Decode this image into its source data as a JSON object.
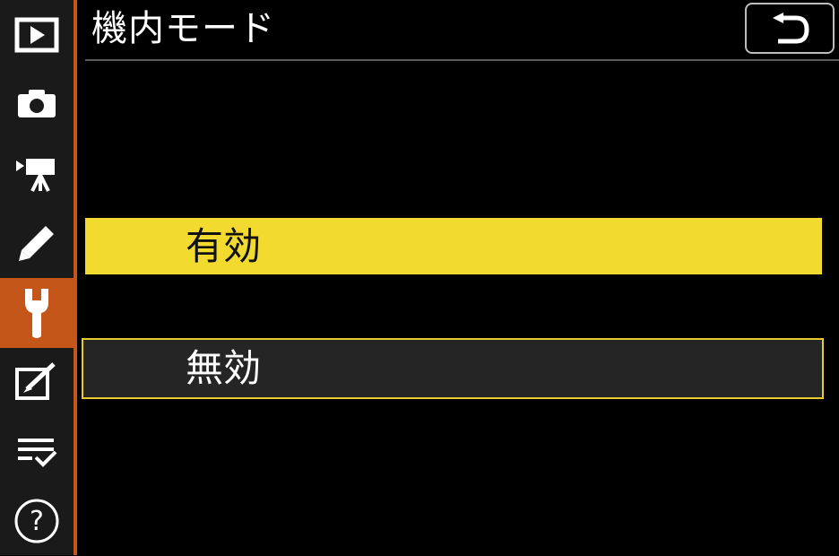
{
  "header": {
    "title": "機内モード",
    "back_icon": "return-arrow-icon"
  },
  "sidebar": {
    "items": [
      {
        "name": "playback",
        "icon": "playback-icon",
        "active": false
      },
      {
        "name": "photo-shooting",
        "icon": "camera-icon",
        "active": false
      },
      {
        "name": "movie-recording",
        "icon": "movie-camera-icon",
        "active": false
      },
      {
        "name": "custom-settings",
        "icon": "pencil-icon",
        "active": false
      },
      {
        "name": "setup",
        "icon": "wrench-icon",
        "active": true
      },
      {
        "name": "retouch",
        "icon": "retouch-icon",
        "active": false
      },
      {
        "name": "my-menu",
        "icon": "checklist-icon",
        "active": false
      },
      {
        "name": "help",
        "icon": "help-icon",
        "active": false
      }
    ]
  },
  "options": [
    {
      "label": "有効",
      "selected": true
    },
    {
      "label": "無効",
      "selected": false
    }
  ],
  "colors": {
    "accent": "#c4561a",
    "highlight": "#f2da2e",
    "focus_border": "#e6cc2a"
  }
}
